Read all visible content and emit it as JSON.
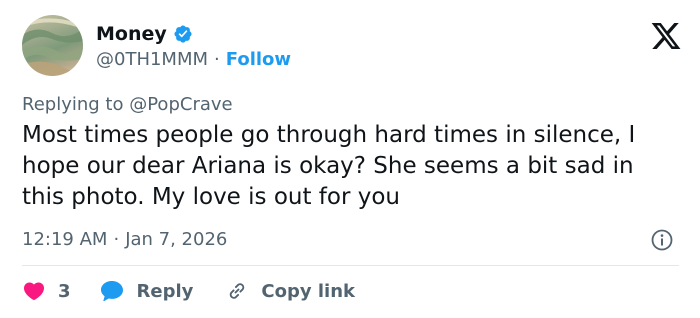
{
  "author": {
    "name": "Money",
    "handle": "@0TH1MMM",
    "separator": "·",
    "follow_label": "Follow",
    "verified": true,
    "verified_color": "#1d9bf0"
  },
  "reply_to": {
    "prefix": "Replying to",
    "mention": "@PopCrave"
  },
  "tweet": {
    "text": "Most times people go through hard times in silence, I hope our dear Ariana is okay? She seems a bit sad in this photo. My love is out for you",
    "time": "12:19 AM",
    "separator": "·",
    "date": "Jan 7, 2026"
  },
  "actions": {
    "like_count": "3",
    "reply_label": "Reply",
    "copy_link_label": "Copy link"
  },
  "icons": {
    "brand": "x-logo-icon",
    "verified": "verified-badge-icon",
    "info": "info-icon",
    "like": "heart-icon",
    "reply": "reply-bubble-icon",
    "copy": "link-icon"
  },
  "colors": {
    "accent": "#1d9bf0",
    "like": "#f91880",
    "muted": "#536471",
    "text": "#0f1419"
  }
}
